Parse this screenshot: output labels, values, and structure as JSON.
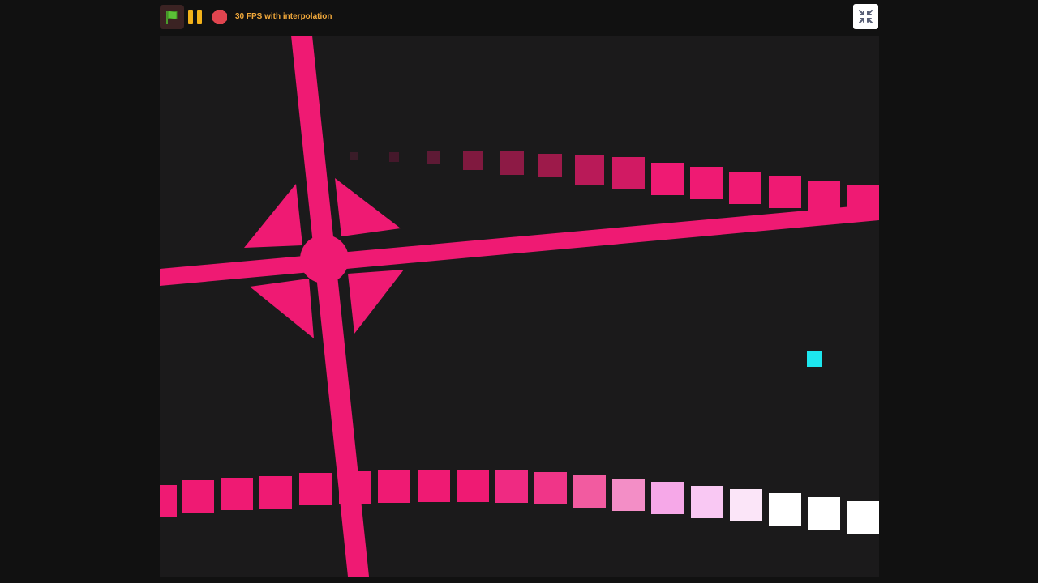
{
  "toolbar": {
    "fps_label": "30 FPS with interpolation",
    "flag_icon": "green-flag-icon",
    "pause_icon": "pause-icon",
    "stop_icon": "stop-icon",
    "exit_fullscreen_icon": "exit-fullscreen-icon"
  },
  "colors": {
    "background": "#111111",
    "stage": "#1b1a1b",
    "accent": "#ef1a73",
    "player": "#1de6ee",
    "fps_text": "#f2a93b",
    "pause": "#f2b21a",
    "stop": "#e0454f",
    "flag": "#5bc236"
  },
  "stage": {
    "top_trail_colors": [
      "#3a1c28",
      "#45182b",
      "#5e1a35",
      "#80193f",
      "#8d1a45",
      "#9d1a4a",
      "#b91a58",
      "#d11a63",
      "#ef1a73",
      "#ef1a73",
      "#ef1a73",
      "#ef1a73",
      "#ef1a73",
      "#ef1a73"
    ],
    "bottom_trail_colors": [
      "#ef1a73",
      "#ef1a73",
      "#ef1a73",
      "#ef1a73",
      "#ef1a73",
      "#ef1a73",
      "#ef1a73",
      "#ef1a73",
      "#ef1a73",
      "#ef2a82",
      "#f03588",
      "#f25ba0",
      "#f38ec6",
      "#f6a8e8",
      "#f9c8f3",
      "#fbe5f8",
      "#ffffff",
      "#ffffff",
      "#ffffff"
    ]
  }
}
